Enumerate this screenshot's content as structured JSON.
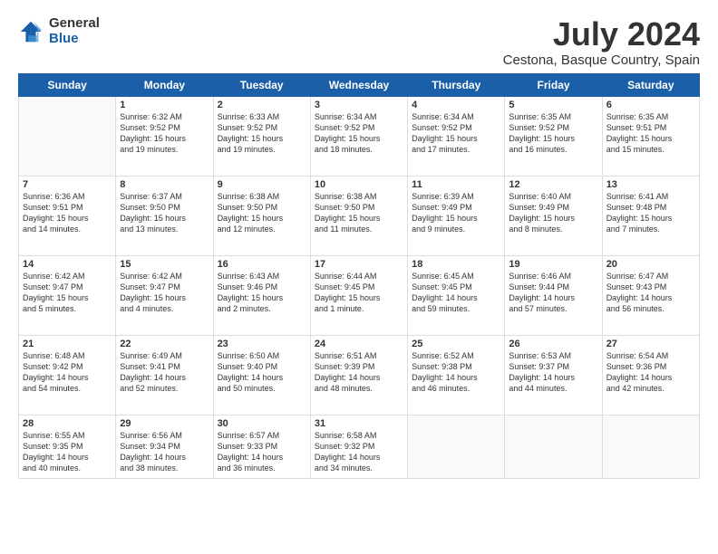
{
  "logo": {
    "general": "General",
    "blue": "Blue"
  },
  "title": "July 2024",
  "subtitle": "Cestona, Basque Country, Spain",
  "headers": [
    "Sunday",
    "Monday",
    "Tuesday",
    "Wednesday",
    "Thursday",
    "Friday",
    "Saturday"
  ],
  "weeks": [
    [
      {
        "day": "",
        "text": ""
      },
      {
        "day": "1",
        "text": "Sunrise: 6:32 AM\nSunset: 9:52 PM\nDaylight: 15 hours\nand 19 minutes."
      },
      {
        "day": "2",
        "text": "Sunrise: 6:33 AM\nSunset: 9:52 PM\nDaylight: 15 hours\nand 19 minutes."
      },
      {
        "day": "3",
        "text": "Sunrise: 6:34 AM\nSunset: 9:52 PM\nDaylight: 15 hours\nand 18 minutes."
      },
      {
        "day": "4",
        "text": "Sunrise: 6:34 AM\nSunset: 9:52 PM\nDaylight: 15 hours\nand 17 minutes."
      },
      {
        "day": "5",
        "text": "Sunrise: 6:35 AM\nSunset: 9:52 PM\nDaylight: 15 hours\nand 16 minutes."
      },
      {
        "day": "6",
        "text": "Sunrise: 6:35 AM\nSunset: 9:51 PM\nDaylight: 15 hours\nand 15 minutes."
      }
    ],
    [
      {
        "day": "7",
        "text": "Sunrise: 6:36 AM\nSunset: 9:51 PM\nDaylight: 15 hours\nand 14 minutes."
      },
      {
        "day": "8",
        "text": "Sunrise: 6:37 AM\nSunset: 9:50 PM\nDaylight: 15 hours\nand 13 minutes."
      },
      {
        "day": "9",
        "text": "Sunrise: 6:38 AM\nSunset: 9:50 PM\nDaylight: 15 hours\nand 12 minutes."
      },
      {
        "day": "10",
        "text": "Sunrise: 6:38 AM\nSunset: 9:50 PM\nDaylight: 15 hours\nand 11 minutes."
      },
      {
        "day": "11",
        "text": "Sunrise: 6:39 AM\nSunset: 9:49 PM\nDaylight: 15 hours\nand 9 minutes."
      },
      {
        "day": "12",
        "text": "Sunrise: 6:40 AM\nSunset: 9:49 PM\nDaylight: 15 hours\nand 8 minutes."
      },
      {
        "day": "13",
        "text": "Sunrise: 6:41 AM\nSunset: 9:48 PM\nDaylight: 15 hours\nand 7 minutes."
      }
    ],
    [
      {
        "day": "14",
        "text": "Sunrise: 6:42 AM\nSunset: 9:47 PM\nDaylight: 15 hours\nand 5 minutes."
      },
      {
        "day": "15",
        "text": "Sunrise: 6:42 AM\nSunset: 9:47 PM\nDaylight: 15 hours\nand 4 minutes."
      },
      {
        "day": "16",
        "text": "Sunrise: 6:43 AM\nSunset: 9:46 PM\nDaylight: 15 hours\nand 2 minutes."
      },
      {
        "day": "17",
        "text": "Sunrise: 6:44 AM\nSunset: 9:45 PM\nDaylight: 15 hours\nand 1 minute."
      },
      {
        "day": "18",
        "text": "Sunrise: 6:45 AM\nSunset: 9:45 PM\nDaylight: 14 hours\nand 59 minutes."
      },
      {
        "day": "19",
        "text": "Sunrise: 6:46 AM\nSunset: 9:44 PM\nDaylight: 14 hours\nand 57 minutes."
      },
      {
        "day": "20",
        "text": "Sunrise: 6:47 AM\nSunset: 9:43 PM\nDaylight: 14 hours\nand 56 minutes."
      }
    ],
    [
      {
        "day": "21",
        "text": "Sunrise: 6:48 AM\nSunset: 9:42 PM\nDaylight: 14 hours\nand 54 minutes."
      },
      {
        "day": "22",
        "text": "Sunrise: 6:49 AM\nSunset: 9:41 PM\nDaylight: 14 hours\nand 52 minutes."
      },
      {
        "day": "23",
        "text": "Sunrise: 6:50 AM\nSunset: 9:40 PM\nDaylight: 14 hours\nand 50 minutes."
      },
      {
        "day": "24",
        "text": "Sunrise: 6:51 AM\nSunset: 9:39 PM\nDaylight: 14 hours\nand 48 minutes."
      },
      {
        "day": "25",
        "text": "Sunrise: 6:52 AM\nSunset: 9:38 PM\nDaylight: 14 hours\nand 46 minutes."
      },
      {
        "day": "26",
        "text": "Sunrise: 6:53 AM\nSunset: 9:37 PM\nDaylight: 14 hours\nand 44 minutes."
      },
      {
        "day": "27",
        "text": "Sunrise: 6:54 AM\nSunset: 9:36 PM\nDaylight: 14 hours\nand 42 minutes."
      }
    ],
    [
      {
        "day": "28",
        "text": "Sunrise: 6:55 AM\nSunset: 9:35 PM\nDaylight: 14 hours\nand 40 minutes."
      },
      {
        "day": "29",
        "text": "Sunrise: 6:56 AM\nSunset: 9:34 PM\nDaylight: 14 hours\nand 38 minutes."
      },
      {
        "day": "30",
        "text": "Sunrise: 6:57 AM\nSunset: 9:33 PM\nDaylight: 14 hours\nand 36 minutes."
      },
      {
        "day": "31",
        "text": "Sunrise: 6:58 AM\nSunset: 9:32 PM\nDaylight: 14 hours\nand 34 minutes."
      },
      {
        "day": "",
        "text": ""
      },
      {
        "day": "",
        "text": ""
      },
      {
        "day": "",
        "text": ""
      }
    ]
  ]
}
